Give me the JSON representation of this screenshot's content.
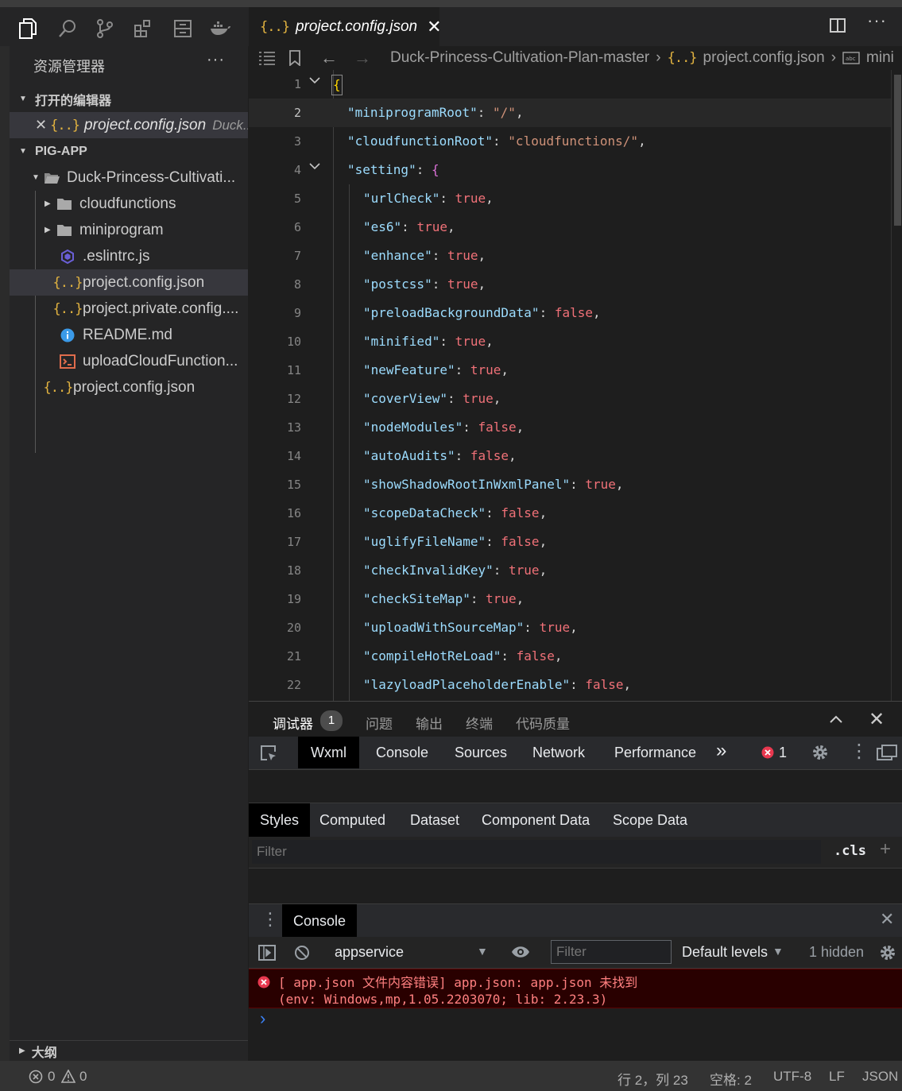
{
  "activity": {
    "icons": [
      "files-icon",
      "search-icon",
      "source-control-icon",
      "extensions-icon",
      "remote-icon",
      "docker-icon"
    ]
  },
  "sidebar": {
    "title": "资源管理器",
    "more": "···",
    "open_editors": {
      "header": "打开的编辑器",
      "item_name": "project.config.json",
      "item_path": "Duck..."
    },
    "project": {
      "header": "PIG-APP",
      "root": "Duck-Princess-Cultivati...",
      "items": [
        {
          "label": "cloudfunctions"
        },
        {
          "label": "miniprogram"
        },
        {
          "label": ".eslintrc.js"
        },
        {
          "label": "project.config.json"
        },
        {
          "label": "project.private.config...."
        },
        {
          "label": "README.md"
        },
        {
          "label": "uploadCloudFunction..."
        },
        {
          "label": "project.config.json"
        }
      ]
    },
    "outline": "大纲"
  },
  "editor": {
    "tab": {
      "title": "project.config.json",
      "close": "✕",
      "json_icon": "{..}"
    },
    "breadcrumb": {
      "folder": "Duck-Princess-Cultivation-Plan-master",
      "file": "project.config.json",
      "symbol": "mini"
    },
    "lines": {
      "n1": "1",
      "n2": "2",
      "n3": "3",
      "n4": "4",
      "n5": "5",
      "n6": "6",
      "n7": "7",
      "n8": "8",
      "n9": "9",
      "n10": "10",
      "n11": "11",
      "n12": "12",
      "n13": "13",
      "n14": "14",
      "n15": "15",
      "n16": "16",
      "n17": "17",
      "n18": "18",
      "n19": "19",
      "n20": "20",
      "n21": "21",
      "n22": "22"
    },
    "code": {
      "l1": "{",
      "l2k": "\"miniprogramRoot\"",
      "l2v": "\"/\"",
      "l3k": "\"cloudfunctionRoot\"",
      "l3v": "\"cloudfunctions/\"",
      "l4k": "\"setting\"",
      "l4v": "{",
      "l5k": "\"urlCheck\"",
      "l5v": "true",
      "l6k": "\"es6\"",
      "l6v": "true",
      "l7k": "\"enhance\"",
      "l7v": "true",
      "l8k": "\"postcss\"",
      "l8v": "true",
      "l9k": "\"preloadBackgroundData\"",
      "l9v": "false",
      "l10k": "\"minified\"",
      "l10v": "true",
      "l11k": "\"newFeature\"",
      "l11v": "true",
      "l12k": "\"coverView\"",
      "l12v": "true",
      "l13k": "\"nodeModules\"",
      "l13v": "false",
      "l14k": "\"autoAudits\"",
      "l14v": "false",
      "l15k": "\"showShadowRootInWxmlPanel\"",
      "l15v": "true",
      "l16k": "\"scopeDataCheck\"",
      "l16v": "false",
      "l17k": "\"uglifyFileName\"",
      "l17v": "false",
      "l18k": "\"checkInvalidKey\"",
      "l18v": "true",
      "l19k": "\"checkSiteMap\"",
      "l19v": "true",
      "l20k": "\"uploadWithSourceMap\"",
      "l20v": "true",
      "l21k": "\"compileHotReLoad\"",
      "l21v": "false",
      "l22k": "\"lazyloadPlaceholderEnable\"",
      "l22v": "false",
      "colon": ": ",
      "comma": ","
    }
  },
  "panel": {
    "tabs": [
      "调试器",
      "问题",
      "输出",
      "终端",
      "代码质量"
    ],
    "debugger_badge": "1",
    "devtools_tabs": [
      "Wxml",
      "Console",
      "Sources",
      "Network",
      "Performance"
    ],
    "more_tabs": "»",
    "error_count": "1",
    "subtabs": [
      "Styles",
      "Computed",
      "Dataset",
      "Component Data",
      "Scope Data"
    ],
    "styles_filter_placeholder": "Filter",
    "cls": ".cls",
    "plus": "+",
    "console_tab": "Console",
    "context": "appservice",
    "console_filter_placeholder": "Filter",
    "levels": "Default levels",
    "hidden": "1 hidden",
    "error_line1": "[ app.json 文件内容错误] app.json: app.json 未找到",
    "error_line2": "(env: Windows,mp,1.05.2203070; lib: 2.23.3)",
    "prompt": "›"
  },
  "status": {
    "errors": "0",
    "warnings": "0",
    "position": "行 2，列 23",
    "spaces": "空格: 2",
    "encoding": "UTF-8",
    "eol": "LF",
    "language": "JSON"
  },
  "colors": {
    "key": "#9cdcfe",
    "string": "#ce9178",
    "bool": "#f07178",
    "bracket": "#ffd700",
    "bracket2": "#da70d6",
    "error_bg": "#290000"
  }
}
